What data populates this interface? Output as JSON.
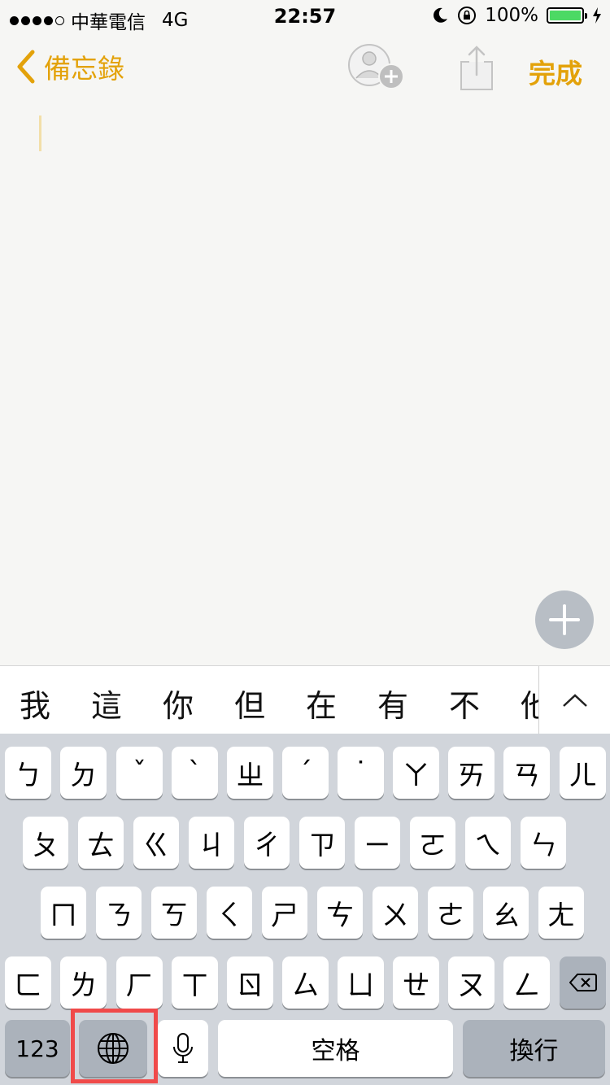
{
  "status_bar": {
    "carrier": "中華電信",
    "network": "4G",
    "time": "22:57",
    "battery": "100%",
    "battery_level": 1.0
  },
  "nav": {
    "back_label": "備忘錄",
    "done_label": "完成",
    "accent_color": "#e3a20a"
  },
  "suggestions": [
    "我",
    "這",
    "你",
    "但",
    "在",
    "有",
    "不",
    "他"
  ],
  "keyboard": {
    "row1": [
      "ㄅ",
      "ㄉ",
      "ˇ",
      "ˋ",
      "ㄓ",
      "ˊ",
      "˙",
      "ㄚ",
      "ㄞ",
      "ㄢ",
      "ㄦ"
    ],
    "row2": [
      "ㄆ",
      "ㄊ",
      "ㄍ",
      "ㄐ",
      "ㄔ",
      "ㄗ",
      "ㄧ",
      "ㄛ",
      "ㄟ",
      "ㄣ"
    ],
    "row3": [
      "ㄇ",
      "ㄋ",
      "ㄎ",
      "ㄑ",
      "ㄕ",
      "ㄘ",
      "ㄨ",
      "ㄜ",
      "ㄠ",
      "ㄤ"
    ],
    "row4": [
      "ㄈ",
      "ㄌ",
      "ㄏ",
      "ㄒ",
      "ㄖ",
      "ㄙ",
      "ㄩ",
      "ㄝ",
      "ㄡ",
      "ㄥ"
    ],
    "numbers_label": "123",
    "space_label": "空格",
    "return_label": "換行"
  },
  "icons": {
    "back": "chevron-left-icon",
    "collaborate": "add-person-icon",
    "share": "share-icon",
    "add": "plus-icon",
    "expand": "chevron-up-icon",
    "delete": "backspace-icon",
    "globe": "globe-icon",
    "mic": "microphone-icon"
  }
}
